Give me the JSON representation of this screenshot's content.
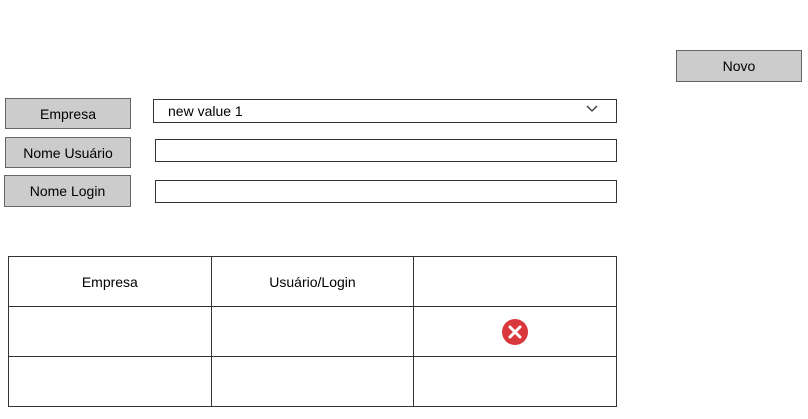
{
  "toolbar": {
    "new_label": "Novo"
  },
  "filters": {
    "empresa_label": "Empresa",
    "empresa_selected": "new value 1",
    "nome_usuario_label": "Nome Usuário",
    "nome_usuario_value": "",
    "nome_login_label": "Nome Login",
    "nome_login_value": ""
  },
  "table": {
    "headers": [
      "Empresa",
      "Usuário/Login",
      ""
    ],
    "rows": [
      {
        "empresa": "",
        "usuario_login": "",
        "action_icon": "delete-icon"
      },
      {
        "empresa": "",
        "usuario_login": "",
        "action_icon": ""
      }
    ]
  },
  "colors": {
    "button_bg": "#cccccc",
    "delete_icon": "#d9383d"
  }
}
